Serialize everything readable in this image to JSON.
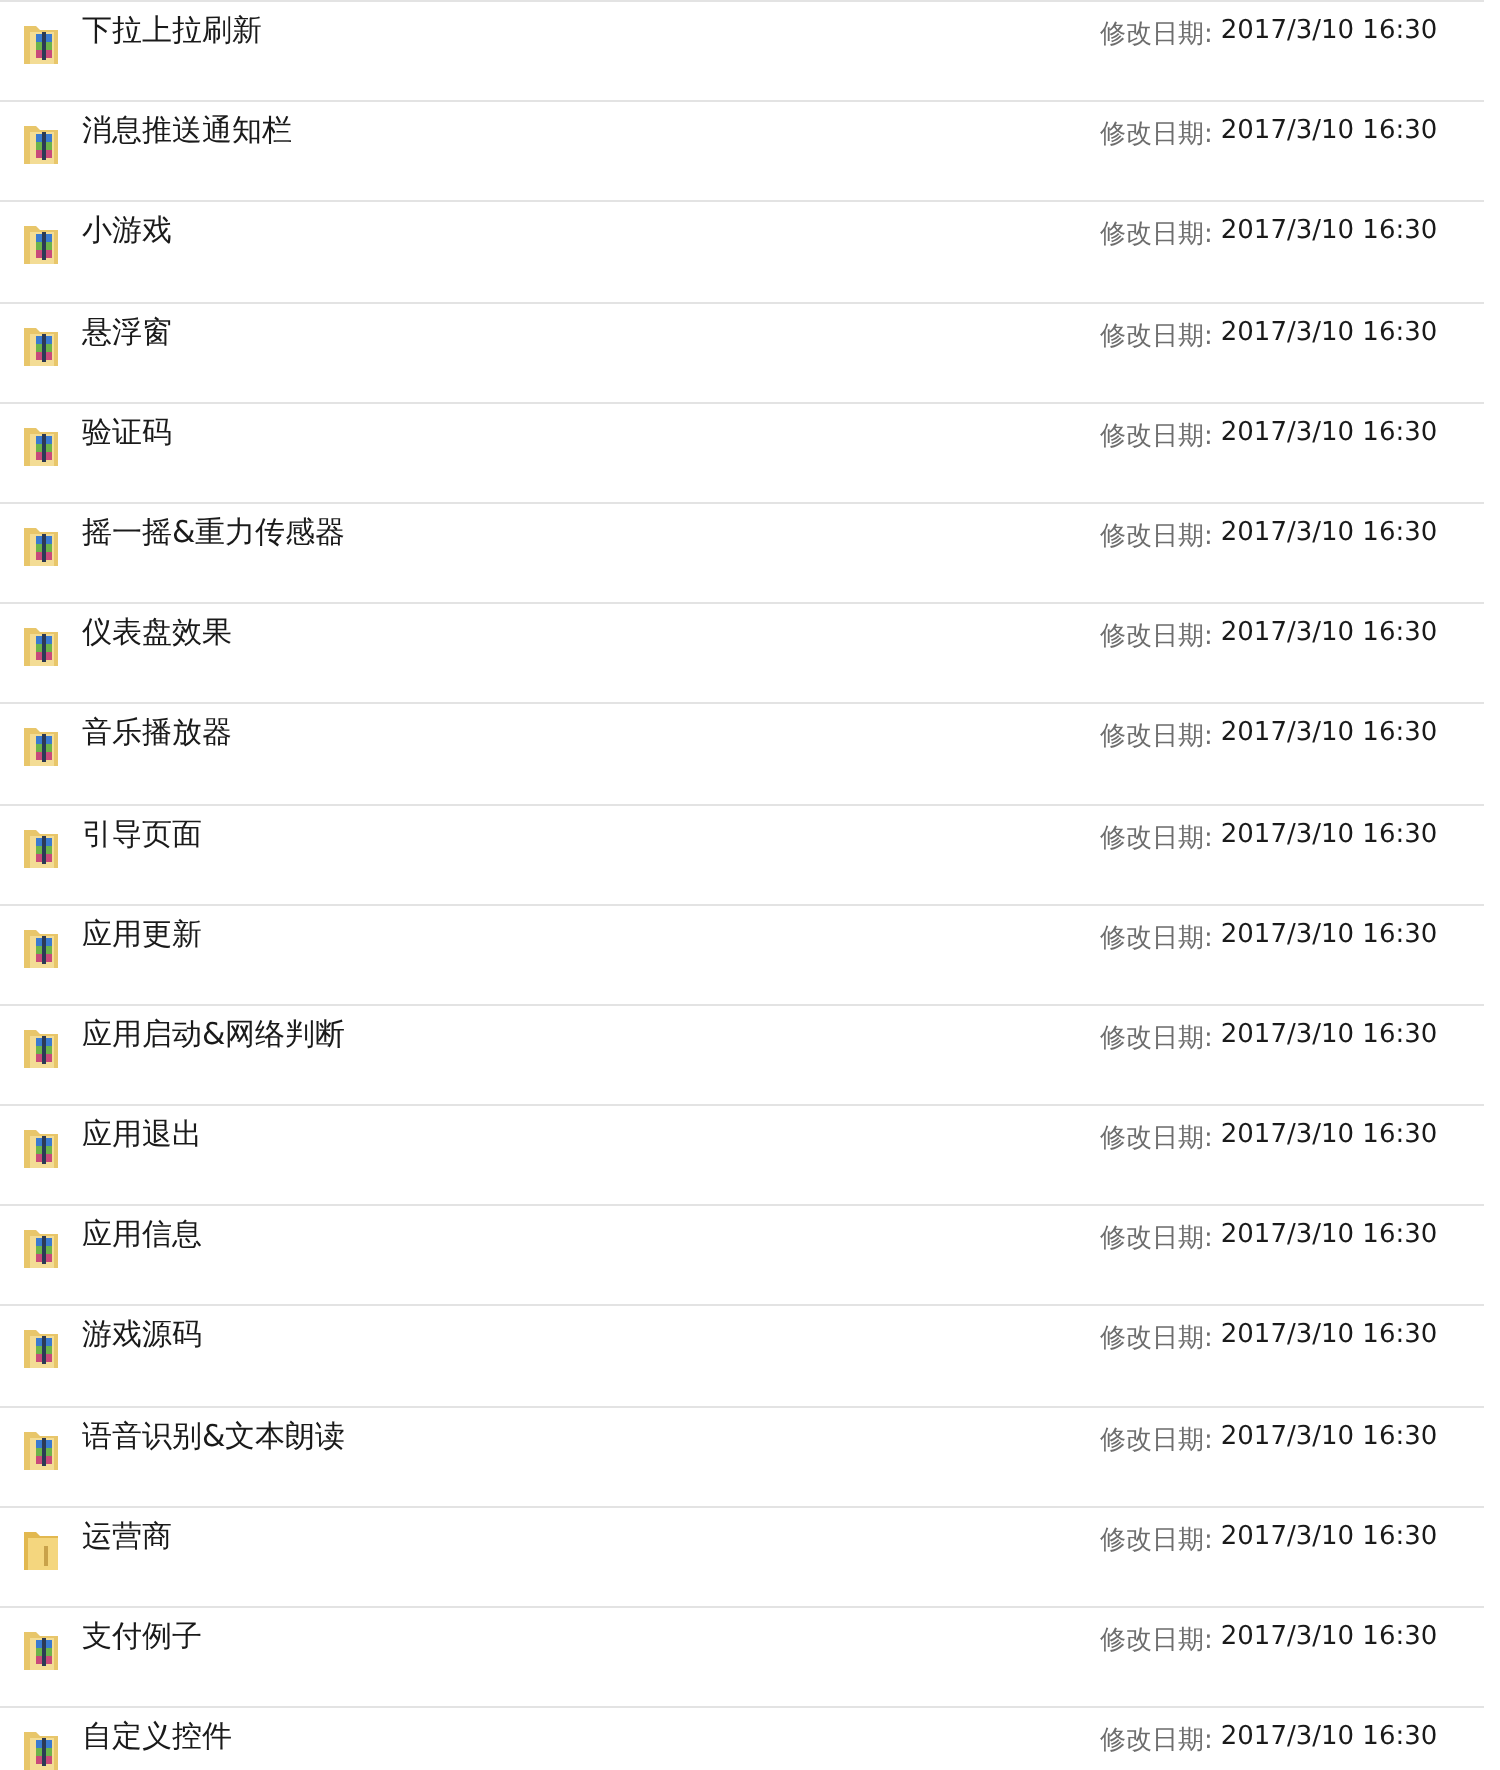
{
  "files": [
    {
      "kind": "archive",
      "name": "下拉上拉刷新",
      "date_label": "修改日期:",
      "date": "2017/3/10 16:30"
    },
    {
      "kind": "archive",
      "name": "消息推送通知栏",
      "date_label": "修改日期:",
      "date": "2017/3/10 16:30"
    },
    {
      "kind": "archive",
      "name": "小游戏",
      "date_label": "修改日期:",
      "date": "2017/3/10 16:30"
    },
    {
      "kind": "archive",
      "name": "悬浮窗",
      "date_label": "修改日期:",
      "date": "2017/3/10 16:30"
    },
    {
      "kind": "archive",
      "name": "验证码",
      "date_label": "修改日期:",
      "date": "2017/3/10 16:30"
    },
    {
      "kind": "archive",
      "name": "摇一摇&重力传感器",
      "date_label": "修改日期:",
      "date": "2017/3/10 16:30"
    },
    {
      "kind": "archive",
      "name": "仪表盘效果",
      "date_label": "修改日期:",
      "date": "2017/3/10 16:30"
    },
    {
      "kind": "archive",
      "name": "音乐播放器",
      "date_label": "修改日期:",
      "date": "2017/3/10 16:30"
    },
    {
      "kind": "archive",
      "name": "引导页面",
      "date_label": "修改日期:",
      "date": "2017/3/10 16:30"
    },
    {
      "kind": "archive",
      "name": "应用更新",
      "date_label": "修改日期:",
      "date": "2017/3/10 16:30"
    },
    {
      "kind": "archive",
      "name": "应用启动&网络判断",
      "date_label": "修改日期:",
      "date": "2017/3/10 16:30"
    },
    {
      "kind": "archive",
      "name": "应用退出",
      "date_label": "修改日期:",
      "date": "2017/3/10 16:30"
    },
    {
      "kind": "archive",
      "name": "应用信息",
      "date_label": "修改日期:",
      "date": "2017/3/10 16:30"
    },
    {
      "kind": "archive",
      "name": "游戏源码",
      "date_label": "修改日期:",
      "date": "2017/3/10 16:30"
    },
    {
      "kind": "archive",
      "name": "语音识别&文本朗读",
      "date_label": "修改日期:",
      "date": "2017/3/10 16:30"
    },
    {
      "kind": "folder",
      "name": "运营商",
      "date_label": "修改日期:",
      "date": "2017/3/10 16:30"
    },
    {
      "kind": "archive",
      "name": "支付例子",
      "date_label": "修改日期:",
      "date": "2017/3/10 16:30"
    },
    {
      "kind": "archive",
      "name": "自定义控件",
      "date_label": "修改日期:",
      "date": "2017/3/10 16:30"
    }
  ]
}
